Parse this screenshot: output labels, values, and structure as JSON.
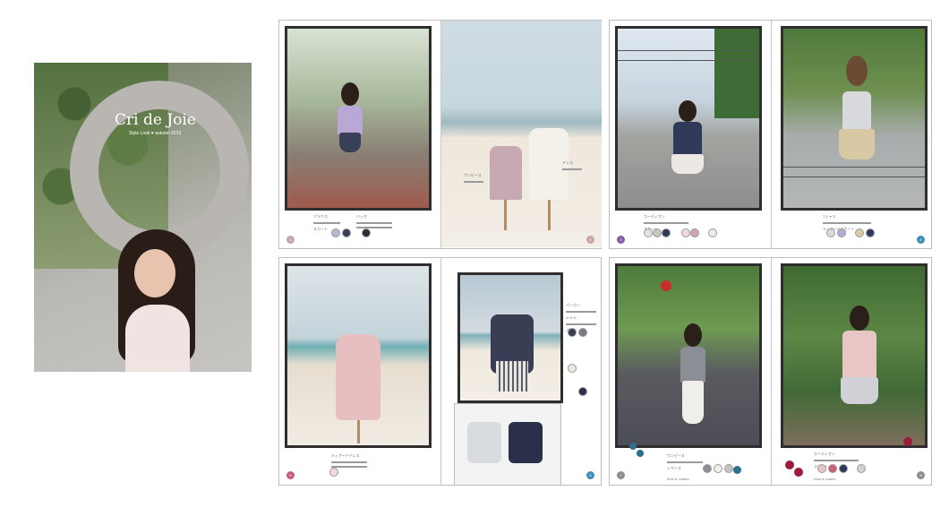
{
  "cover": {
    "title": "Cri de Joie",
    "subtitle": "Style Look ♥ autumn 2013"
  },
  "spreads": [
    {
      "id": "spread-1",
      "left_caption": [
        "ブラウス",
        "スカート",
        "バッグ"
      ],
      "right_caption": [
        "ワンピース",
        "ドレス"
      ]
    },
    {
      "id": "spread-2",
      "left_caption": [
        "カーディガン",
        "スカート"
      ],
      "right_caption": [
        "Tシャツ",
        "ティアードスカート"
      ]
    },
    {
      "id": "spread-3",
      "left_caption": [
        "ティアードドレス"
      ],
      "right_caption": [
        "パーカー",
        "シャツ",
        "パンツ"
      ]
    },
    {
      "id": "spread-4",
      "left_caption": [
        "ワンピース",
        "レギンス"
      ],
      "right_caption": [
        "カーディガン",
        "スカート"
      ],
      "brand_labels": [
        "Kids & Ladies",
        "Kids & Ladies"
      ]
    }
  ],
  "colors": {
    "frame": "#2e2e2e",
    "page_number_purple": "#8a5aa8",
    "page_number_blue": "#3f8fb8",
    "page_number_pink": "#c65a82",
    "grape_red": "#9b1d3a",
    "grape_blue": "#2f6f8f"
  }
}
